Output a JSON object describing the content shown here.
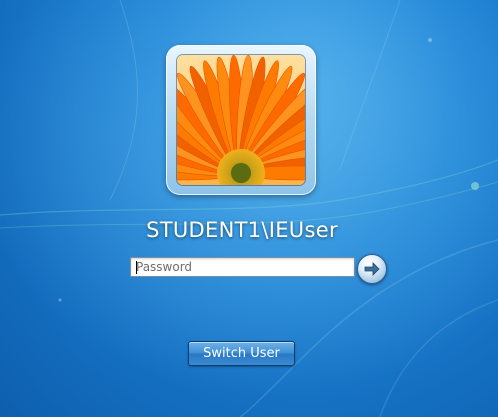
{
  "user": {
    "name": "STUDENT1\\IEUser",
    "avatar_icon": "orange-gerbera-flower-picture"
  },
  "password_field": {
    "placeholder": "Password",
    "value": ""
  },
  "submit": {
    "icon": "arrow-right-icon"
  },
  "switch_user": {
    "label": "Switch User"
  },
  "colors": {
    "background": "#1f84d6",
    "text": "#ffffff",
    "button": "#3f8fd6"
  }
}
